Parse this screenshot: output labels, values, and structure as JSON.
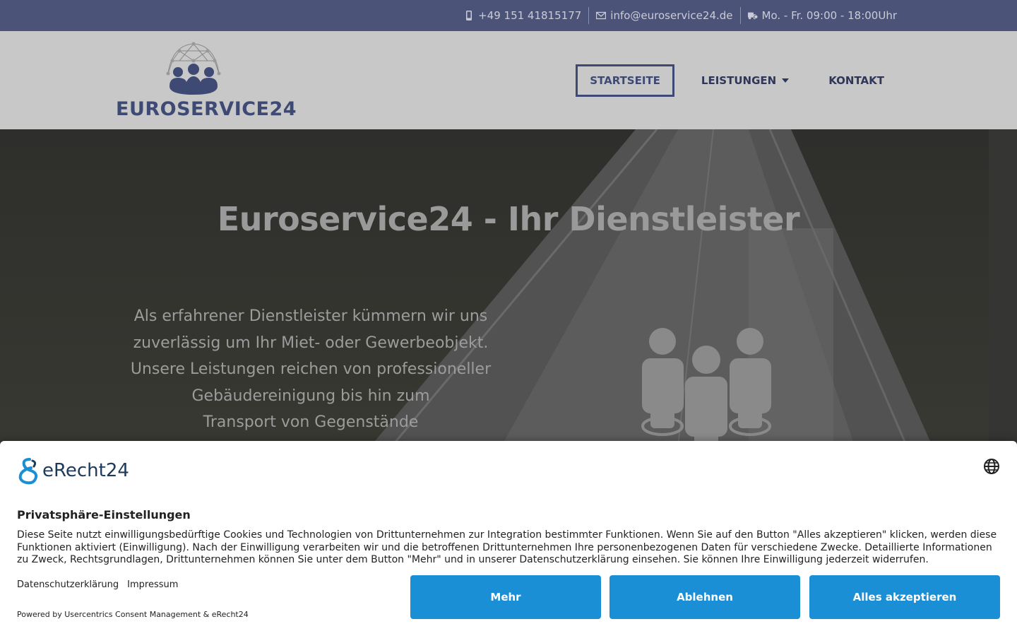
{
  "topbar": {
    "phone": "+49 151 41815177",
    "email": "info@euroservice24.de",
    "hours": "Mo. - Fr. 09:00 - 18:00Uhr"
  },
  "header": {
    "logo_text": "EUROSERVICE24",
    "nav": [
      {
        "label": "STARTSEITE"
      },
      {
        "label": "LEISTUNGEN"
      },
      {
        "label": "KONTAKT"
      }
    ]
  },
  "hero": {
    "title": "Euroservice24 - Ihr Dienstleister",
    "lines": [
      "Als erfahrener Dienstleister kümmern wir uns",
      "zuverlässig um Ihr Miet- oder Gewerbeobjekt.",
      "Unsere Leistungen reichen von professioneller",
      "Gebäudereinigung bis hin zum",
      "Transport von Gegenstände"
    ]
  },
  "consent": {
    "logo_text": "eRecht24",
    "title": "Privatsphäre-Einstellungen",
    "body": "Diese Seite nutzt einwilligungsbedürftige Cookies und Technologien von Drittunternehmen zur Integration bestimmter Funktionen. Wenn Sie auf den Button \"Alles akzeptieren\" klicken, werden diese Funktionen aktiviert (Einwilligung). Nach der Einwilligung verarbeiten wir und die betroffenen Drittunternehmen Ihre personenbezogenen Daten für verschiedene Zwecke. Detaillierte Informationen zu Zweck, Rechtsgrundlagen, Drittunternehmen können Sie unter dem Button \"Mehr\" und in unserer Datenschutzerklärung einsehen. Sie können Ihre Einwilligung jederzeit widerrufen.",
    "link_privacy": "Datenschutzerklärung",
    "link_imprint": "Impressum",
    "powered": "Powered by Usercentrics Consent Management & eRecht24",
    "btn_more": "Mehr",
    "btn_deny": "Ablehnen",
    "btn_accept": "Alles akzeptieren"
  },
  "colors": {
    "brand": "#3f4a74",
    "topbar": "#4b5478",
    "button": "#1a8fd6"
  }
}
